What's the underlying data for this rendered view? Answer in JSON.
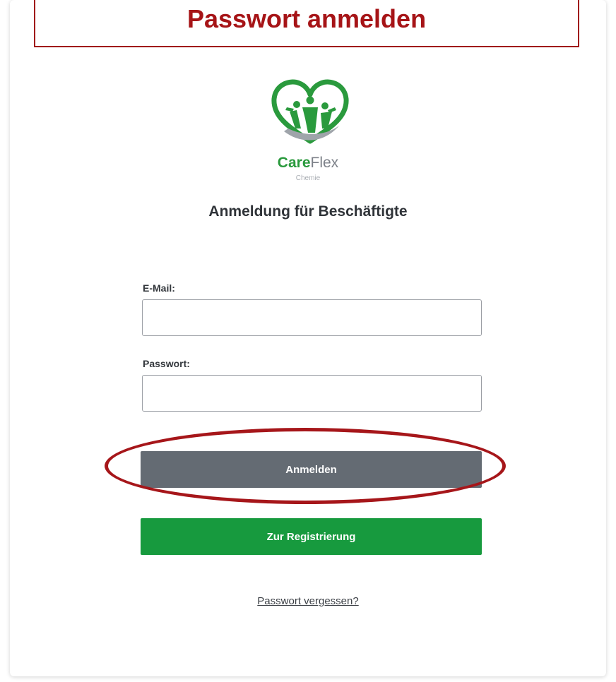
{
  "annotation": {
    "banner_title": "Passwort anmelden",
    "banner_color": "#a61417"
  },
  "brand": {
    "name_bold": "Care",
    "name_regular": "Flex",
    "subtitle": "Chemie",
    "accent_color": "#2a9a3d"
  },
  "form": {
    "heading": "Anmeldung für Beschäftigte",
    "email_label": "E-Mail:",
    "email_value": "",
    "password_label": "Passwort:",
    "password_value": "",
    "login_button": "Anmelden",
    "register_button": "Zur Registrierung",
    "forgot_link": "Passwort vergessen?"
  },
  "colors": {
    "login_button": "#646b73",
    "register_button": "#179a3e"
  }
}
